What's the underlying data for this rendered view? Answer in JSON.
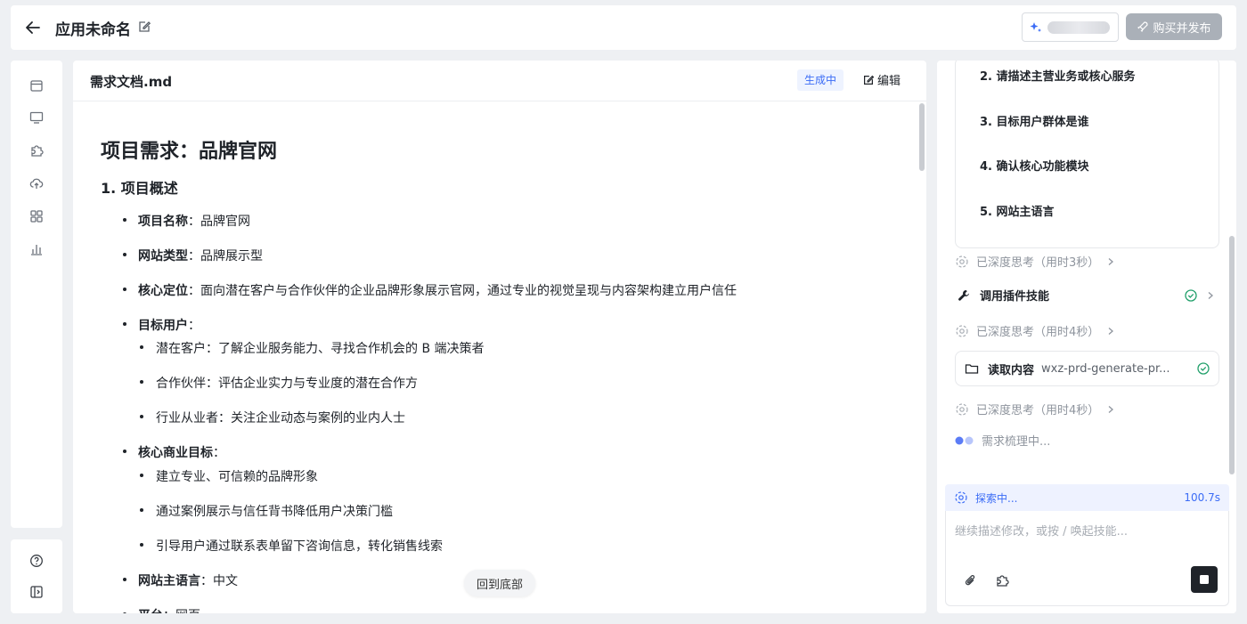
{
  "header": {
    "title": "应用未命名",
    "publish_label": "购买并发布"
  },
  "doc": {
    "filename": "需求文档.md",
    "status_badge": "生成中",
    "edit_label": "编辑",
    "heading": "项目需求：品牌官网",
    "section1": "1. 项目概述",
    "items": [
      {
        "label": "项目名称",
        "value": "品牌官网"
      },
      {
        "label": "网站类型",
        "value": "品牌展示型"
      },
      {
        "label": "核心定位",
        "value": "面向潜在客户与合作伙伴的企业品牌形象展示官网，通过专业的视觉呈现与内容架构建立用户信任"
      },
      {
        "label": "目标用户",
        "value": ""
      },
      {
        "label": "核心商业目标",
        "value": ""
      },
      {
        "label": "网站主语言",
        "value": "中文"
      },
      {
        "label": "平台",
        "value": "网页"
      }
    ],
    "target_users": [
      "潜在客户：了解企业服务能力、寻找合作机会的 B 端决策者",
      "合作伙伴：评估企业实力与专业度的潜在合作方",
      "行业从业者：关注企业动态与案例的业内人士"
    ],
    "business_goals": [
      "建立专业、可信赖的品牌形象",
      "通过案例展示与信任背书降低用户决策门槛",
      "引导用户通过联系表单留下咨询信息，转化销售线索"
    ],
    "back_to_bottom": "回到底部"
  },
  "chat": {
    "questions": [
      "2. 请描述主营业务或核心服务",
      "3. 目标用户群体是谁",
      "4. 确认核心功能模块",
      "5. 网站主语言"
    ],
    "think1": "已深度思考（用时3秒）",
    "plugin_label": "调用插件技能",
    "think2": "已深度思考（用时4秒）",
    "read_label": "读取内容",
    "read_file": "wxz-prd-generate-pr...",
    "think3": "已深度思考（用时4秒）",
    "loading_label": "需求梳理中...",
    "explore_label": "探索中...",
    "explore_time": "100.7s",
    "input_placeholder": "继续描述修改，或按 / 唤起技能..."
  },
  "colors": {
    "accent": "#3b6cf6",
    "success": "#22a06b",
    "publish_disabled": "#aab0b8"
  }
}
